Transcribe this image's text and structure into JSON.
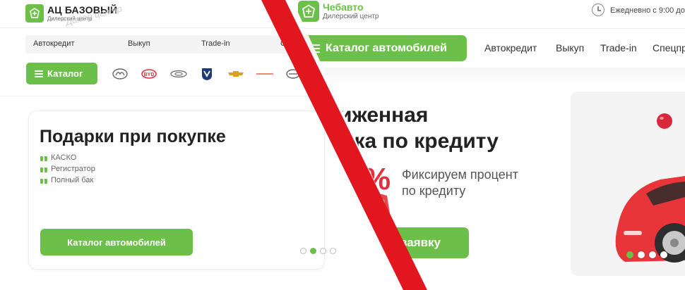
{
  "left": {
    "logo": {
      "title": "АЦ БАЗОВЫЙ",
      "subtitle": "Дилерский центр",
      "watermark": "Дилер центр"
    },
    "nav": [
      "Автокредит",
      "Выкуп",
      "Trade-in",
      "Спе"
    ],
    "catalog_label": "Каталог",
    "brands": [
      "geely-logo",
      "byd-logo",
      "chery-logo",
      "changan-logo",
      "chevrolet-logo",
      "brand-logo",
      "haval-logo"
    ],
    "promo": {
      "title": "Подарки при покупке",
      "items": [
        "КАСКО",
        "Регистратор",
        "Полный бак"
      ],
      "button": "Каталог автомобилей"
    },
    "slider": {
      "count": 4,
      "active": 1
    }
  },
  "right": {
    "logo": {
      "title": "Чебавто",
      "subtitle": "Дилерский центр"
    },
    "hours": "Ежедневно с 9:00 до",
    "catalog_button": "Каталог автомобилей",
    "nav": [
      "Автокредит",
      "Выкуп",
      "Trade-in",
      "Спецпр"
    ],
    "banner": {
      "title_line1": "иженная",
      "title_line2": "вка по кредиту",
      "percent": "%",
      "sub_line1": "Фиксируем процент",
      "sub_line2": "по кредиту",
      "button": "заявку"
    },
    "slider": {
      "count": 4,
      "active": 0
    }
  },
  "colors": {
    "accent": "#6cc04a",
    "red": "#e2303c",
    "overlay_line": "#e1161e"
  }
}
